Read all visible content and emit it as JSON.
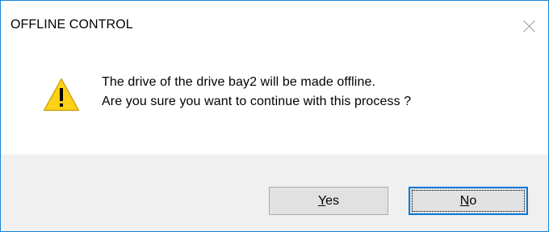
{
  "dialog": {
    "title": "OFFLINE CONTROL",
    "icon": "warning-icon",
    "message_line1": "The drive of the drive bay2 will be made offline.",
    "message_line2": "Are you sure you want to continue with this process ?",
    "buttons": {
      "yes": {
        "mnemonic": "Y",
        "rest": "es"
      },
      "no": {
        "mnemonic": "N",
        "rest": "o"
      }
    }
  },
  "colors": {
    "border": "#1883d7",
    "footer_bg": "#f0f0f0",
    "button_bg": "#e1e1e1",
    "focus_border": "#0078d7",
    "warning_fill": "#fcd116"
  }
}
